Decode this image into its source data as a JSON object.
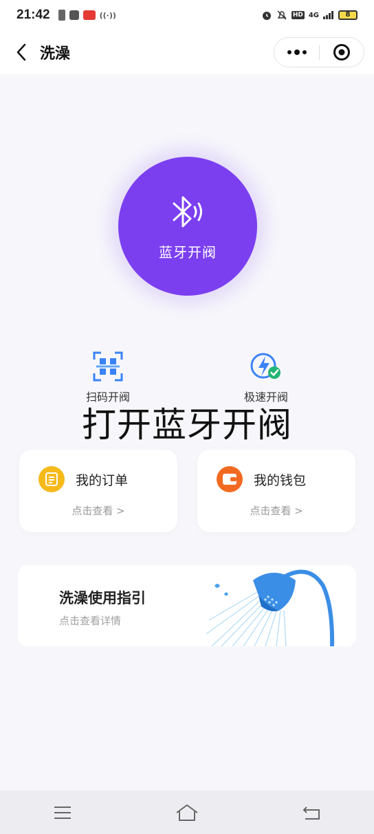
{
  "status_bar": {
    "time": "21:42",
    "signal": "4G",
    "battery": "8"
  },
  "nav": {
    "title": "洗澡"
  },
  "bluetooth_button": {
    "label": "蓝牙开阀",
    "color": "#7b3ff0"
  },
  "modes": [
    {
      "label": "扫码开阀",
      "icon": "qr-scan-icon"
    },
    {
      "label": "极速开阀",
      "icon": "lightning-check-icon"
    }
  ],
  "overlay_title": "打开蓝牙开阀",
  "cards": [
    {
      "title": "我的订单",
      "sub": "点击查看 >",
      "icon": "order-icon",
      "color": "#f5b91a"
    },
    {
      "title": "我的钱包",
      "sub": "点击查看 >",
      "icon": "wallet-icon",
      "color": "#f26a22"
    }
  ],
  "guide": {
    "title": "洗澡使用指引",
    "sub": "点击查看详情"
  }
}
